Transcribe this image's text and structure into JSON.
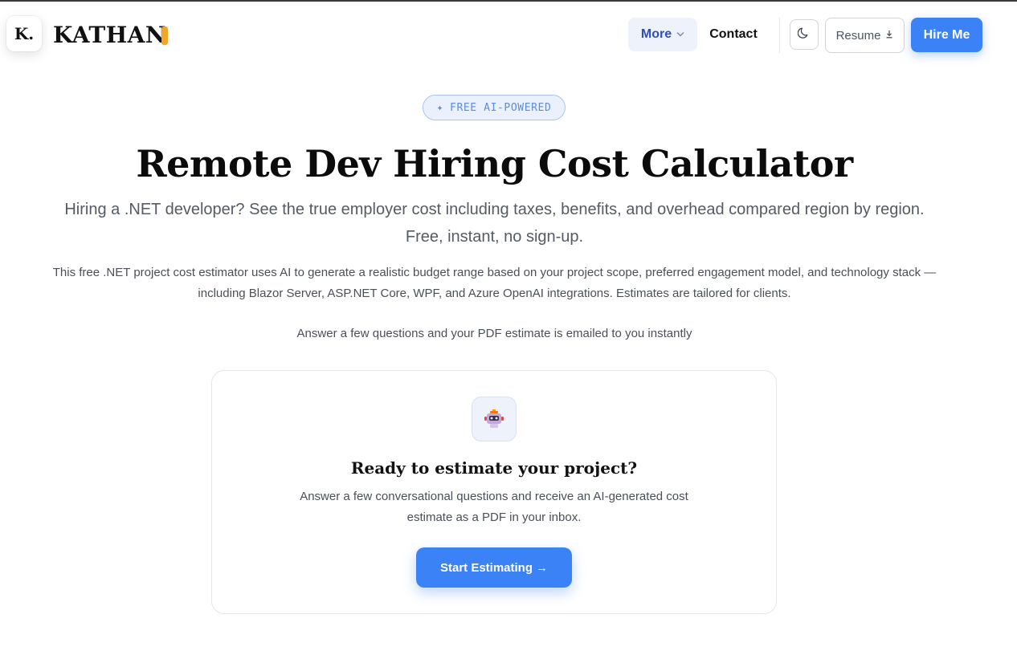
{
  "header": {
    "logo_letter": "K.",
    "logo_text": "KATHAN",
    "nav_more": "More",
    "nav_contact": "Contact",
    "resume_label": "Resume",
    "hire_label": "Hire Me",
    "icons": {
      "more": "chevron-down-icon",
      "theme": "moon-icon",
      "resume": "download-icon"
    }
  },
  "hero": {
    "badge_icon": "✦",
    "badge_text": "FREE AI-POWERED",
    "title": "Remote Dev Hiring Cost Calculator",
    "subtitle": "Hiring a .NET developer? See the true employer cost including taxes, benefits, and overhead compared region by region. Free, instant, no sign-up.",
    "description": "This free .NET project cost estimator uses AI to generate a realistic budget range based on your project scope, preferred engagement model, and technology stack — including Blazor Server, ASP.NET Core, WPF, and Azure OpenAI integrations. Estimates are tailored for clients.",
    "note": "Answer a few questions and your PDF estimate is emailed to you instantly"
  },
  "card": {
    "icon": "robot-icon",
    "title": "Ready to estimate your project?",
    "text": "Answer a few conversational questions and receive an AI-generated cost estimate as a PDF in your inbox.",
    "button_label": "Start Estimating",
    "button_arrow": "→"
  },
  "colors": {
    "accent": "#3b82f6",
    "logo_bar": "#f5a524",
    "badge_text": "#5b8ee0"
  }
}
